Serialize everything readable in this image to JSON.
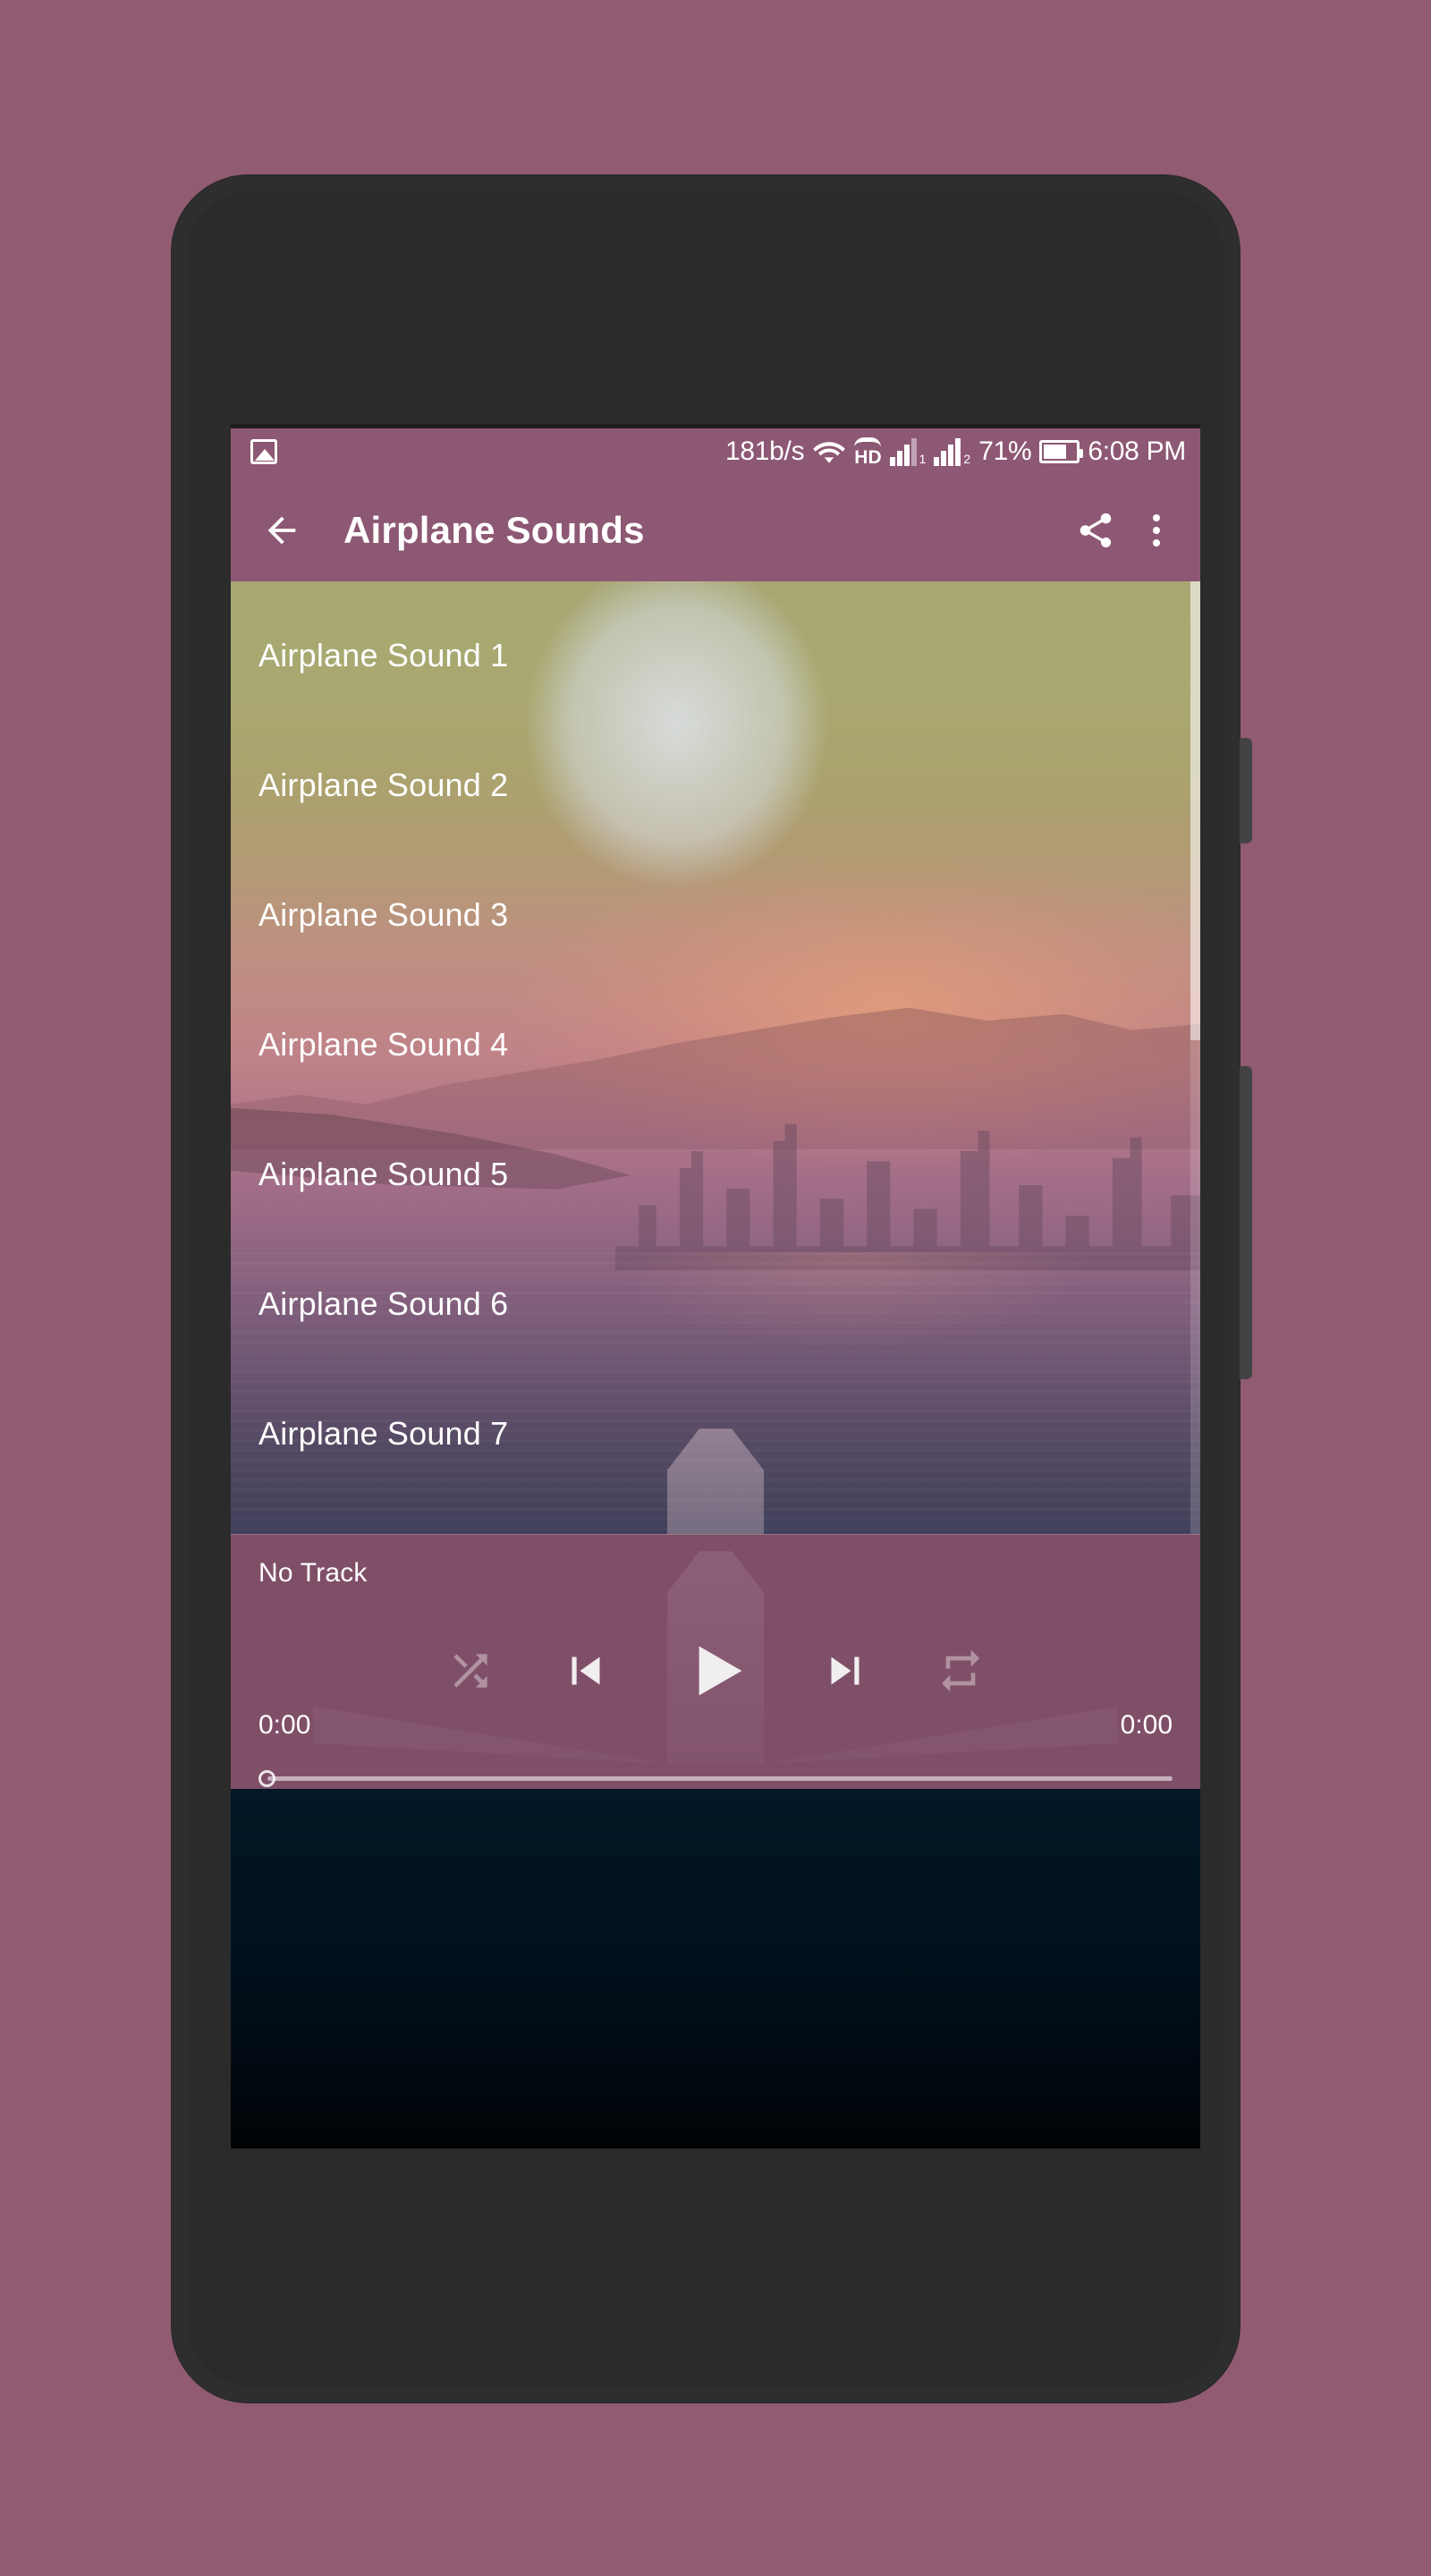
{
  "theme": {
    "page_background": "#915b72",
    "accent": "#8d5873",
    "device_body": "#2e2e2e",
    "text_on_accent": "#ffffff"
  },
  "status_bar": {
    "picture_icon": "picture-icon",
    "network_speed": "181b/s",
    "wifi_icon": "wifi-icon",
    "hd_label": "HD",
    "sim1_label": "1",
    "sim2_label": "2",
    "battery_percent": "71%",
    "battery_level": 71,
    "clock": "6:08 PM"
  },
  "app_bar": {
    "back_icon": "back-arrow-icon",
    "title": "Airplane Sounds",
    "share_icon": "share-icon",
    "overflow_icon": "overflow-menu-icon"
  },
  "sound_list": {
    "items": [
      {
        "label": "Airplane Sound 1"
      },
      {
        "label": "Airplane Sound 2"
      },
      {
        "label": "Airplane Sound 3"
      },
      {
        "label": "Airplane Sound 4"
      },
      {
        "label": "Airplane Sound 5"
      },
      {
        "label": "Airplane Sound 6"
      },
      {
        "label": "Airplane Sound 7"
      }
    ]
  },
  "player": {
    "track_title": "No Track",
    "shuffle_icon": "shuffle-icon",
    "previous_icon": "previous-track-icon",
    "play_icon": "play-icon",
    "next_icon": "next-track-icon",
    "repeat_icon": "repeat-icon",
    "elapsed_time": "0:00",
    "total_time": "0:00",
    "seek_progress": 0,
    "shuffle_enabled": false,
    "repeat_enabled": false
  },
  "device": {
    "front_camera": "front-camera",
    "earpiece": "earpiece-speaker",
    "proximity_sensor": "proximity-sensor",
    "power_button": "power-button",
    "volume_button": "volume-button"
  }
}
